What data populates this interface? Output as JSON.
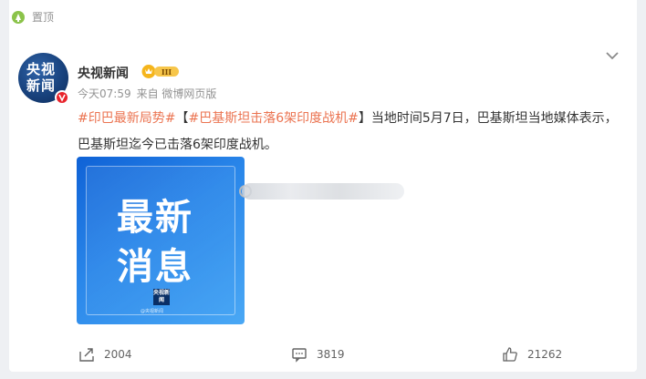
{
  "pinned": {
    "label": "置顶",
    "icon": "pin-icon"
  },
  "post": {
    "author": {
      "name": "央视新闻",
      "avatar_line1": "央视",
      "avatar_line2": "新闻",
      "badge": "verified-icon",
      "medal": "III"
    },
    "time": "今天07:59",
    "source": "来自 微博网页版",
    "topic1": "#印巴最新局势#",
    "bracket_open": "【",
    "topic2": "#巴基斯坦击落6架印度战机#",
    "bracket_close": "】",
    "body": "当地时间5月7日，巴基斯坦当地媒体表示，巴基斯坦迄今已击落6架印度战机。",
    "image": {
      "line1": "最新",
      "line2": "消息",
      "logo": "央视新闻",
      "caption": "@央视新闻"
    }
  },
  "actions": {
    "forward": {
      "icon": "forward-icon",
      "count": "2004"
    },
    "comment": {
      "icon": "comment-icon",
      "count": "3819"
    },
    "like": {
      "icon": "like-icon",
      "count": "21262"
    }
  },
  "colors": {
    "topic": "#eb7350",
    "accent_blue": "#1d76e2"
  }
}
